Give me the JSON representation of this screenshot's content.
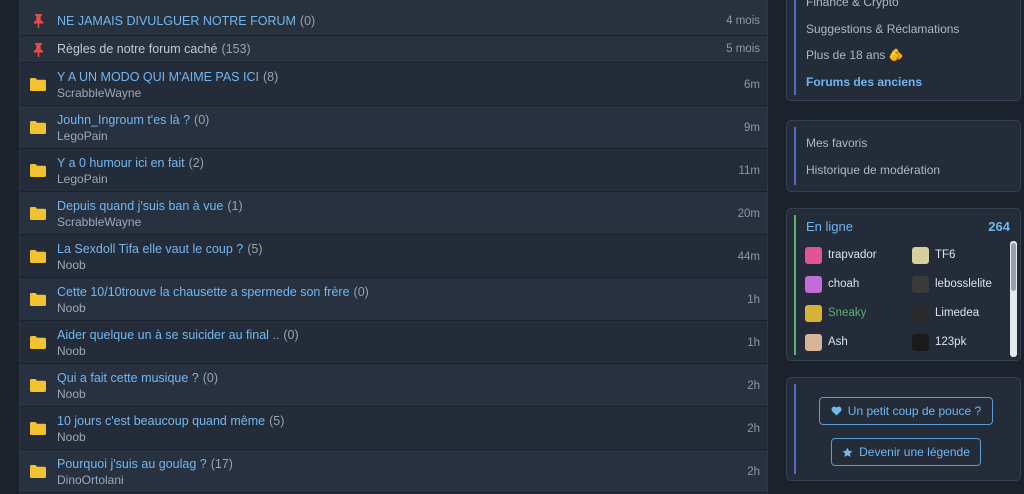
{
  "topics": {
    "pinned": [
      {
        "title": "NE JAMAIS DIVULGUER NOTRE FORUM",
        "count": "(0)",
        "time": "4 mois"
      },
      {
        "title": "Règles de notre forum caché",
        "count": "(153)",
        "time": "5 mois"
      }
    ],
    "items": [
      {
        "title": "Y A UN MODO QUI M'AIME PAS ICI",
        "count": "(8)",
        "author": "ScrabbleWayne",
        "time": "6m"
      },
      {
        "title": "Jouhn_Ingroum t'es là ?",
        "count": "(0)",
        "author": "LegoPain",
        "time": "9m"
      },
      {
        "title": "Y a 0 humour ici en fait",
        "count": "(2)",
        "author": "LegoPain",
        "time": "11m"
      },
      {
        "title": "Depuis quand j'suis ban à vue",
        "count": "(1)",
        "author": "ScrabbleWayne",
        "time": "20m"
      },
      {
        "title": "La Sexdoll Tifa elle vaut le coup ?",
        "count": "(5)",
        "author": "Noob",
        "time": "44m"
      },
      {
        "title": "Cette 10/10trouve la chausette a spermede son frère",
        "count": "(0)",
        "author": "Noob",
        "time": "1h"
      },
      {
        "title": "Aider quelque un à se suicider au final ..",
        "count": "(0)",
        "author": "Noob",
        "time": "1h"
      },
      {
        "title": "Qui a fait cette musique ?",
        "count": "(0)",
        "author": "Noob",
        "time": "2h"
      },
      {
        "title": "10 jours c'est beaucoup quand même",
        "count": "(5)",
        "author": "Noob",
        "time": "2h"
      },
      {
        "title": "Pourquoi j'suis au goulag ?",
        "count": "(17)",
        "author": "DinoOrtolani",
        "time": "2h"
      }
    ]
  },
  "sidebar": {
    "forums": {
      "items": [
        "Finance & Crypto",
        "Suggestions & Réclamations",
        "Plus de 18 ans 🫵",
        "Forums des anciens"
      ]
    },
    "tools": {
      "items": [
        "Mes favoris",
        "Historique de modération"
      ]
    },
    "online": {
      "title": "En ligne",
      "count": "264",
      "users": [
        {
          "name": "trapvador",
          "avatar_color": "#e0559a"
        },
        {
          "name": "TF6",
          "avatar_color": "#d9cf9a"
        },
        {
          "name": "choah",
          "avatar_color": "#c46bd8"
        },
        {
          "name": "lebosslelite",
          "avatar_color": "#3a3a3a"
        },
        {
          "name": "Sneaky",
          "avatar_color": "#d8b233"
        },
        {
          "name": "Limedea",
          "avatar_color": "#2b2b2b"
        },
        {
          "name": "Ash",
          "avatar_color": "#d9b39a"
        },
        {
          "name": "123pk",
          "avatar_color": "#1a1a1a"
        }
      ]
    },
    "support": {
      "thumb_button": "Un petit coup de pouce ?",
      "legend_button": "Devenir une légende"
    }
  },
  "colors": {
    "accent": "#74b7ef",
    "pin": "#e34c4c",
    "folder": "#f2c230",
    "online_green": "#57b36e"
  }
}
